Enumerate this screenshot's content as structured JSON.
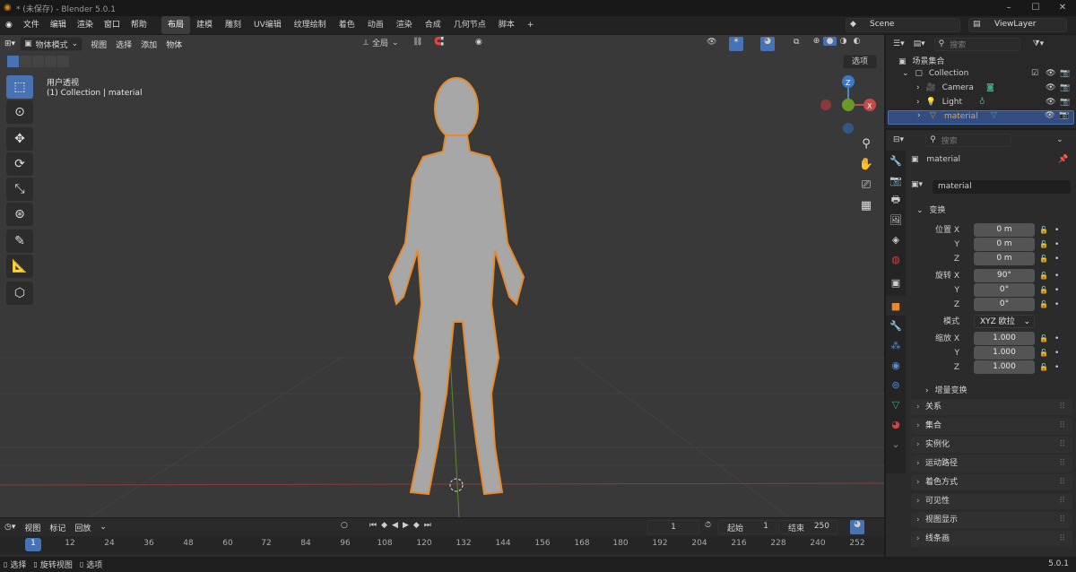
{
  "window": {
    "title": "* (未保存) - Blender 5.0.1"
  },
  "menu": [
    "文件",
    "编辑",
    "渲染",
    "窗口",
    "帮助"
  ],
  "workspaces": [
    "布局",
    "建模",
    "雕刻",
    "UV编辑",
    "纹理绘制",
    "着色",
    "动画",
    "渲染",
    "合成",
    "几何节点",
    "脚本"
  ],
  "active_workspace": "布局",
  "scene": {
    "name": "Scene",
    "view_layer": "ViewLayer"
  },
  "viewport": {
    "mode": "物体模式",
    "menus": [
      "视图",
      "选择",
      "添加",
      "物体"
    ],
    "orientation": "全局",
    "options": "选项",
    "overlay_title": "用户透视",
    "overlay_sub": "(1) Collection | material"
  },
  "outliner": {
    "search_placeholder": "搜索",
    "root": "场景集合",
    "collection": "Collection",
    "items": [
      "Camera",
      "Light",
      "material"
    ]
  },
  "properties": {
    "search_placeholder": "搜索",
    "object_name": "material",
    "object_field": "material",
    "transform_label": "变换",
    "location": {
      "label": "位置 X",
      "x": "0 m",
      "y": "0 m",
      "z": "0 m"
    },
    "rotation": {
      "label": "旋转 X",
      "x": "90°",
      "y": "0°",
      "z": "0°"
    },
    "mode_label": "模式",
    "mode_value": "XYZ 欧拉",
    "scale": {
      "label": "缩放 X",
      "x": "1.000",
      "y": "1.000",
      "z": "1.000"
    },
    "delta": "增量变换",
    "panels": [
      "关系",
      "集合",
      "实例化",
      "运动路径",
      "着色方式",
      "可见性",
      "视图显示",
      "线条画"
    ]
  },
  "timeline": {
    "menus": [
      "视图",
      "标记",
      "回放"
    ],
    "current_frame": "1",
    "start_label": "起始",
    "start": "1",
    "end_label": "结束",
    "end": "250",
    "ticks": [
      "1",
      "12",
      "24",
      "36",
      "48",
      "60",
      "72",
      "84",
      "96",
      "108",
      "120",
      "132",
      "144",
      "156",
      "168",
      "180",
      "192",
      "204",
      "216",
      "228",
      "240",
      "252"
    ]
  },
  "status": {
    "select": "选择",
    "rotate": "旋转视图",
    "options": "选项",
    "version": "5.0.1"
  }
}
